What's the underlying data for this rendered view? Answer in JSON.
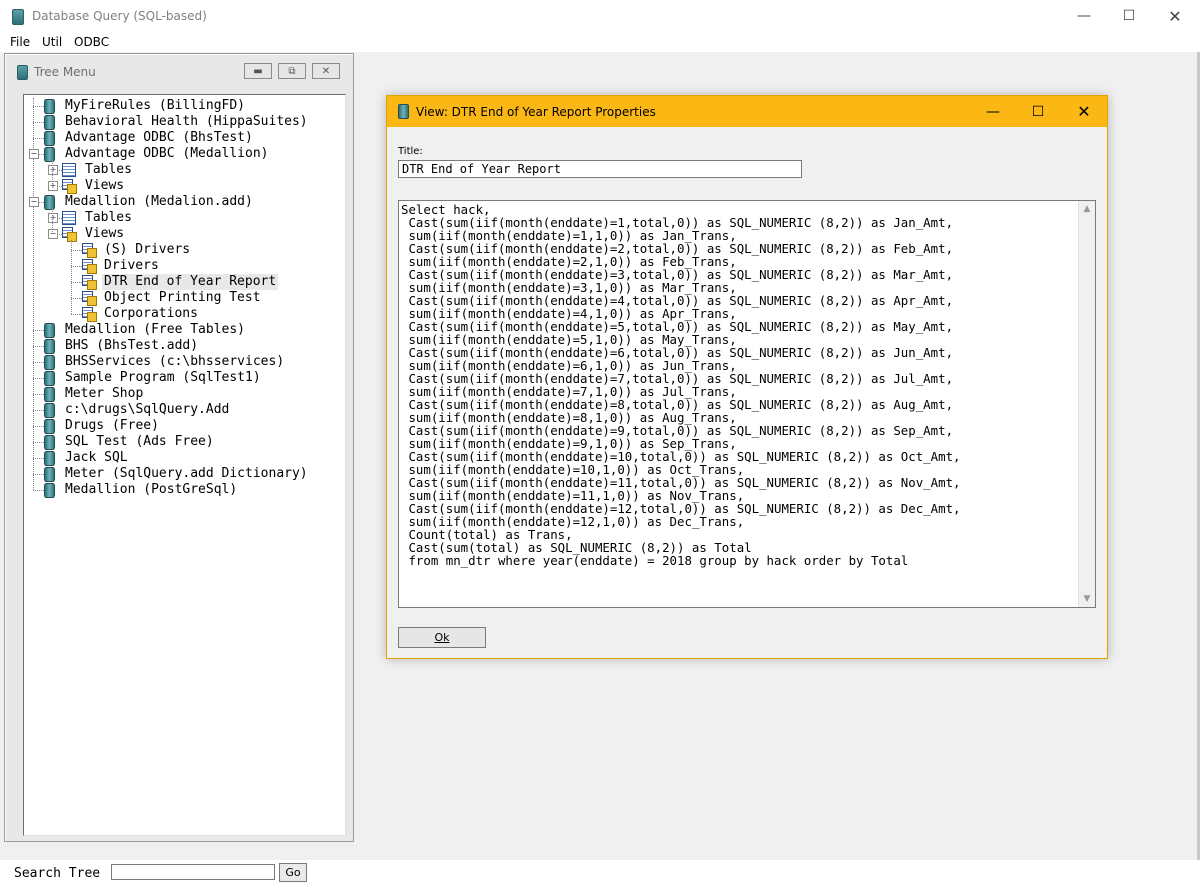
{
  "app": {
    "title": "Database Query (SQL-based)"
  },
  "menu": [
    {
      "label": "File"
    },
    {
      "label": "Util"
    },
    {
      "label": "ODBC"
    }
  ],
  "tree": {
    "title": "Tree Menu",
    "items": [
      {
        "label": "MyFireRules (BillingFD)",
        "level": 0,
        "icon": "database-icon",
        "expander": "none"
      },
      {
        "label": "Behavioral Health (HippaSuites)",
        "level": 0,
        "icon": "database-icon",
        "expander": "none"
      },
      {
        "label": "Advantage ODBC (BhsTest)",
        "level": 0,
        "icon": "database-icon",
        "expander": "none"
      },
      {
        "label": "Advantage ODBC (Medallion)",
        "level": 0,
        "icon": "database-icon",
        "expander": "minus"
      },
      {
        "label": "Tables",
        "level": 1,
        "icon": "table-icon",
        "expander": "plus"
      },
      {
        "label": "Views",
        "level": 1,
        "icon": "view-icon",
        "expander": "plus"
      },
      {
        "label": "Medallion (Medalion.add)",
        "level": 0,
        "icon": "database-icon",
        "expander": "minus"
      },
      {
        "label": "Tables",
        "level": 1,
        "icon": "table-icon",
        "expander": "plus"
      },
      {
        "label": "Views",
        "level": 1,
        "icon": "view-icon",
        "expander": "minus"
      },
      {
        "label": "(S) Drivers",
        "level": 2,
        "icon": "view-icon",
        "expander": "none"
      },
      {
        "label": "Drivers",
        "level": 2,
        "icon": "view-icon",
        "expander": "none"
      },
      {
        "label": "DTR End of Year Report",
        "level": 2,
        "icon": "view-icon",
        "expander": "none",
        "selected": true
      },
      {
        "label": "Object Printing Test",
        "level": 2,
        "icon": "view-icon",
        "expander": "none"
      },
      {
        "label": "Corporations",
        "level": 2,
        "icon": "view-icon",
        "expander": "none"
      },
      {
        "label": "Medallion (Free Tables)",
        "level": 0,
        "icon": "database-icon",
        "expander": "none"
      },
      {
        "label": "BHS (BhsTest.add)",
        "level": 0,
        "icon": "database-icon",
        "expander": "none"
      },
      {
        "label": "BHSServices (c:\\bhsservices)",
        "level": 0,
        "icon": "database-icon",
        "expander": "none"
      },
      {
        "label": "Sample Program (SqlTest1)",
        "level": 0,
        "icon": "database-icon",
        "expander": "none"
      },
      {
        "label": "Meter Shop",
        "level": 0,
        "icon": "database-icon",
        "expander": "none"
      },
      {
        "label": "c:\\drugs\\SqlQuery.Add",
        "level": 0,
        "icon": "database-icon",
        "expander": "none"
      },
      {
        "label": "Drugs (Free)",
        "level": 0,
        "icon": "database-icon",
        "expander": "none"
      },
      {
        "label": "SQL Test (Ads Free)",
        "level": 0,
        "icon": "database-icon",
        "expander": "none"
      },
      {
        "label": "Jack SQL",
        "level": 0,
        "icon": "database-icon",
        "expander": "none"
      },
      {
        "label": "Meter (SqlQuery.add Dictionary)",
        "level": 0,
        "icon": "database-icon",
        "expander": "none"
      },
      {
        "label": "Medallion (PostGreSql)",
        "level": 0,
        "icon": "database-icon",
        "expander": "none"
      }
    ]
  },
  "search": {
    "label": "Search Tree",
    "value": "",
    "go_label": "Go"
  },
  "dialog": {
    "title": "View: DTR End of Year Report Properties",
    "title_field_label": "Title:",
    "title_value": "DTR End of Year Report",
    "sql_lines": [
      "Select hack,",
      " Cast(sum(iif(month(enddate)=1,total,0)) as SQL_NUMERIC (8,2)) as Jan_Amt,",
      " sum(iif(month(enddate)=1,1,0)) as Jan_Trans,",
      " Cast(sum(iif(month(enddate)=2,total,0)) as SQL_NUMERIC (8,2)) as Feb_Amt,",
      " sum(iif(month(enddate)=2,1,0)) as Feb_Trans,",
      " Cast(sum(iif(month(enddate)=3,total,0)) as SQL_NUMERIC (8,2)) as Mar_Amt,",
      " sum(iif(month(enddate)=3,1,0)) as Mar_Trans,",
      " Cast(sum(iif(month(enddate)=4,total,0)) as SQL_NUMERIC (8,2)) as Apr_Amt,",
      " sum(iif(month(enddate)=4,1,0)) as Apr_Trans,",
      " Cast(sum(iif(month(enddate)=5,total,0)) as SQL_NUMERIC (8,2)) as May_Amt,",
      " sum(iif(month(enddate)=5,1,0)) as May_Trans,",
      " Cast(sum(iif(month(enddate)=6,total,0)) as SQL_NUMERIC (8,2)) as Jun_Amt,",
      " sum(iif(month(enddate)=6,1,0)) as Jun_Trans,",
      " Cast(sum(iif(month(enddate)=7,total,0)) as SQL_NUMERIC (8,2)) as Jul_Amt,",
      " sum(iif(month(enddate)=7,1,0)) as Jul_Trans,",
      " Cast(sum(iif(month(enddate)=8,total,0)) as SQL_NUMERIC (8,2)) as Aug_Amt,",
      " sum(iif(month(enddate)=8,1,0)) as Aug_Trans,",
      " Cast(sum(iif(month(enddate)=9,total,0)) as SQL_NUMERIC (8,2)) as Sep_Amt,",
      " sum(iif(month(enddate)=9,1,0)) as Sep_Trans,",
      " Cast(sum(iif(month(enddate)=10,total,0)) as SQL_NUMERIC (8,2)) as Oct_Amt,",
      " sum(iif(month(enddate)=10,1,0)) as Oct_Trans,",
      " Cast(sum(iif(month(enddate)=11,total,0)) as SQL_NUMERIC (8,2)) as Nov_Amt,",
      " sum(iif(month(enddate)=11,1,0)) as Nov_Trans,",
      " Cast(sum(iif(month(enddate)=12,total,0)) as SQL_NUMERIC (8,2)) as Dec_Amt,",
      " sum(iif(month(enddate)=12,1,0)) as Dec_Trans,",
      " Count(total) as Trans,",
      " Cast(sum(total) as SQL_NUMERIC (8,2)) as Total",
      " from mn_dtr where year(enddate) = 2018 group by hack order by Total"
    ],
    "ok_label": "Ok"
  },
  "colors": {
    "dialog_titlebar": "#fbb814",
    "client_bg": "#f0f0f0",
    "app_title_text": "#808080"
  }
}
